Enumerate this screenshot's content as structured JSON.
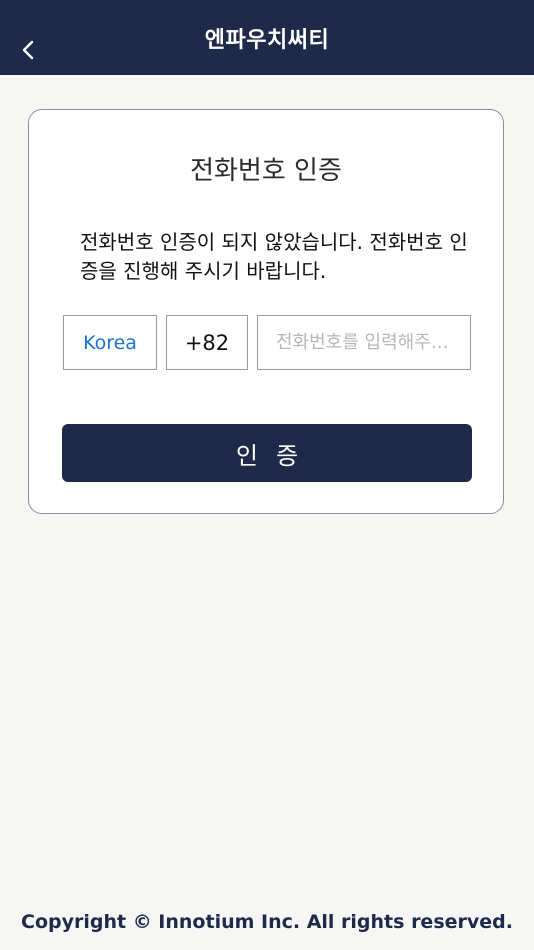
{
  "header": {
    "title": "엔파우치써티",
    "back_icon": "chevron-left-icon"
  },
  "card": {
    "title": "전화번호 인증",
    "description": "전화번호 인증이 되지 않았습니다. 전화번호 인증을 진행해 주시기 바랍니다.",
    "country": "Korea",
    "dial_code": "+82",
    "phone_value": "",
    "phone_placeholder": "전화번호를 입력해주세요",
    "verify_label": "인증"
  },
  "footer": {
    "copyright": "Copyright © Innotium Inc. All rights reserved."
  },
  "colors": {
    "primary": "#1f2a4b",
    "link": "#1a73d1",
    "background": "#f6f6f4"
  }
}
